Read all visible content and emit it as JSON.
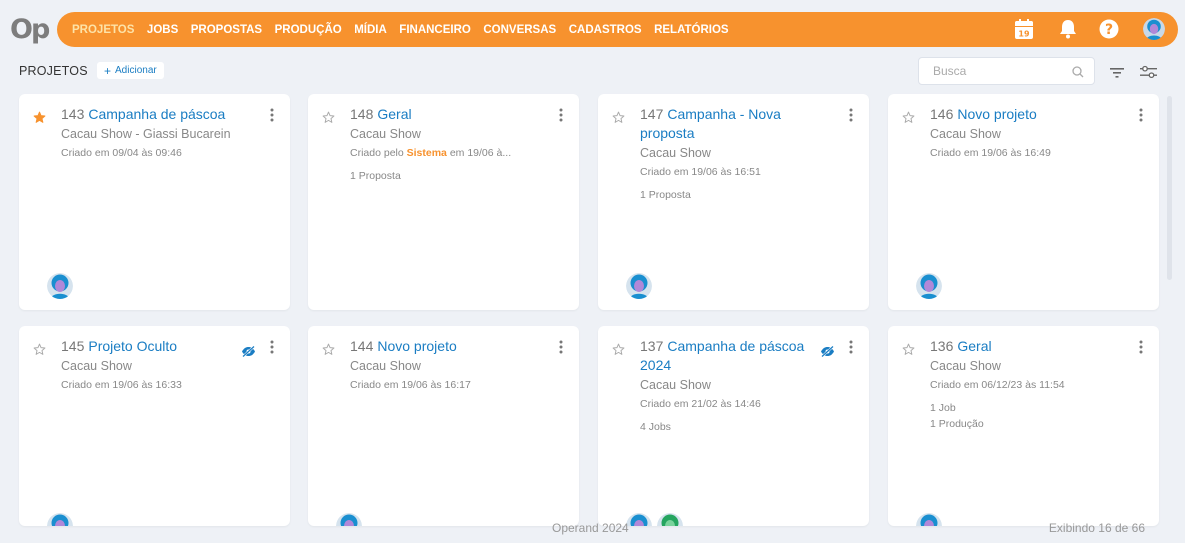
{
  "app": {
    "logo": "Op"
  },
  "nav": {
    "items": [
      {
        "label": "PROJETOS",
        "active": true
      },
      {
        "label": "JOBS"
      },
      {
        "label": "PROPOSTAS"
      },
      {
        "label": "PRODUÇÃO"
      },
      {
        "label": "MÍDIA"
      },
      {
        "label": "FINANCEIRO"
      },
      {
        "label": "CONVERSAS"
      },
      {
        "label": "CADASTROS"
      },
      {
        "label": "RELATÓRIOS"
      }
    ],
    "calendar_day": "19",
    "icons": [
      "calendar-icon",
      "bell-icon",
      "help-icon",
      "user-avatar"
    ]
  },
  "toolbar": {
    "title": "PROJETOS",
    "add_label": "Adicionar",
    "search_placeholder": "Busca"
  },
  "cards": [
    {
      "num": "143",
      "title": "Campanha de páscoa",
      "client": "Cacau Show - Giassi Bucarein",
      "created": "Criado em 09/04 às 09:46",
      "starred": true,
      "hidden": false,
      "stats": [],
      "avatars": 1
    },
    {
      "num": "148",
      "title": "Geral",
      "client": "Cacau Show",
      "created_prefix": "Criado pelo",
      "created_by": "Sistema",
      "created_suffix": "em 19/06 à...",
      "starred": false,
      "hidden": false,
      "stats": [
        "1 Proposta"
      ],
      "avatars": 0
    },
    {
      "num": "147",
      "title": "Campanha - Nova proposta",
      "client": "Cacau Show",
      "created": "Criado em 19/06 às 16:51",
      "starred": false,
      "hidden": false,
      "stats": [
        "1 Proposta"
      ],
      "avatars": 1
    },
    {
      "num": "146",
      "title": "Novo projeto",
      "client": "Cacau Show",
      "created": "Criado em 19/06 às 16:49",
      "starred": false,
      "hidden": false,
      "stats": [],
      "avatars": 1
    },
    {
      "num": "145",
      "title": "Projeto Oculto",
      "client": "Cacau Show",
      "created": "Criado em 19/06 às 16:33",
      "starred": false,
      "hidden": true,
      "stats": [],
      "avatars": 1
    },
    {
      "num": "144",
      "title": "Novo projeto",
      "client": "Cacau Show",
      "created": "Criado em 19/06 às 16:17",
      "starred": false,
      "hidden": false,
      "stats": [],
      "avatars": 1
    },
    {
      "num": "137",
      "title": "Campanha de páscoa 2024",
      "client": "Cacau Show",
      "created": "Criado em 21/02 às 14:46",
      "starred": false,
      "hidden": true,
      "stats": [
        "4 Jobs"
      ],
      "avatars": 2
    },
    {
      "num": "136",
      "title": "Geral",
      "client": "Cacau Show",
      "created": "Criado em 06/12/23 às 11:54",
      "starred": false,
      "hidden": false,
      "stats": [
        "1 Job",
        "1 Produção"
      ],
      "avatars": 1
    }
  ],
  "footer": {
    "center": "Operand 2024",
    "right": "Exibindo 16 de 66"
  },
  "colors": {
    "accent": "#f7922e",
    "link": "#1a7dc3",
    "background": "#eef1f6"
  }
}
